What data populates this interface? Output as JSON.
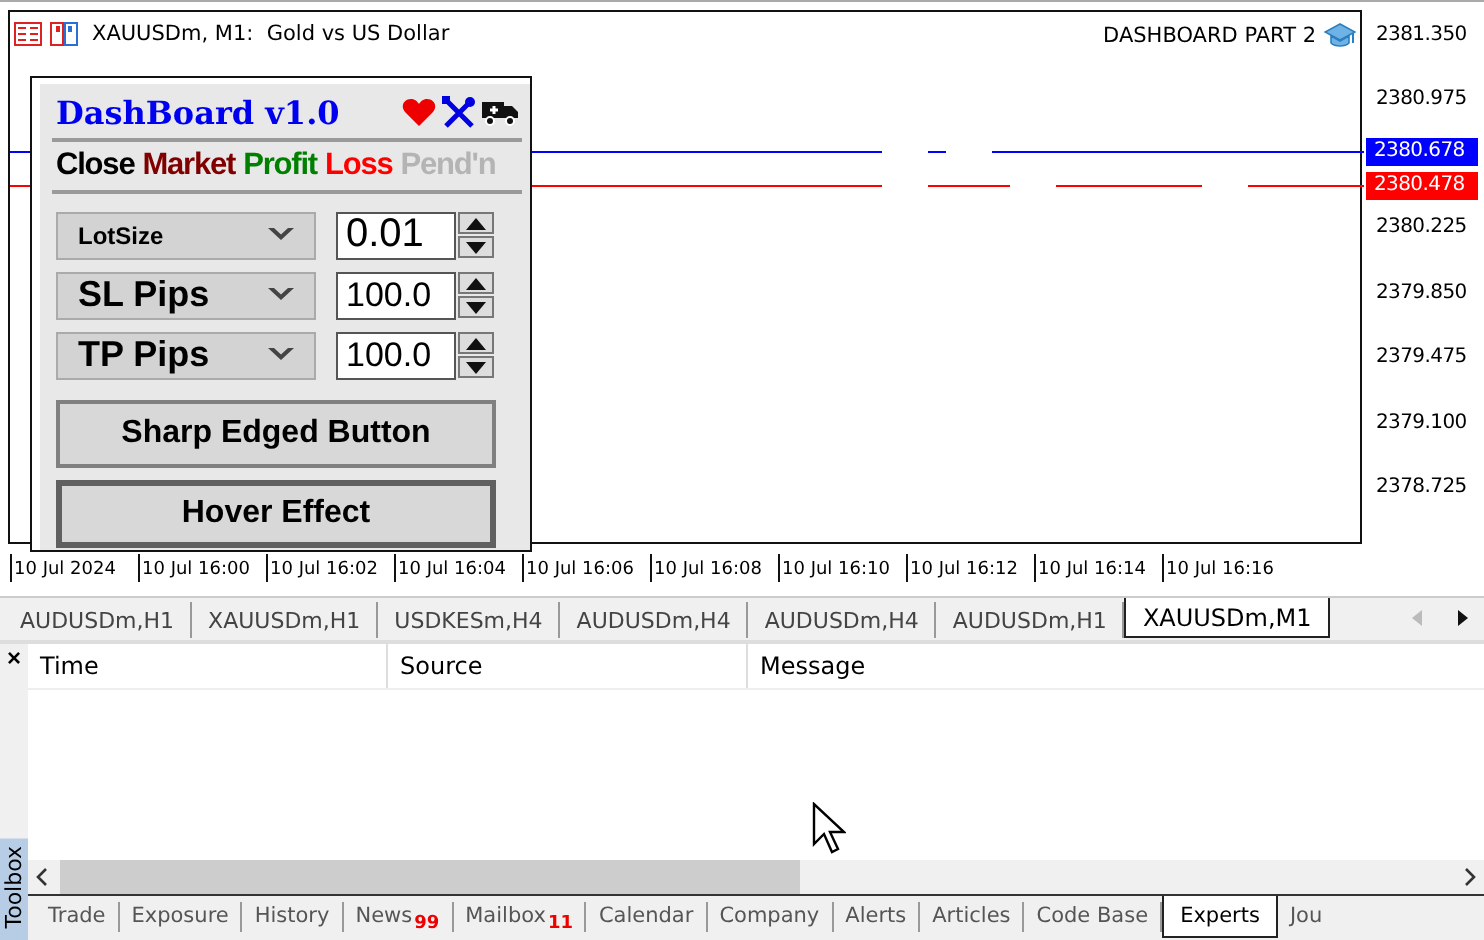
{
  "chart": {
    "title": "XAUUSDm, M1:  Gold vs US Dollar",
    "caption": "DASHBOARD PART 2",
    "price_ticks": [
      "2381.350",
      "2380.975",
      "2380.225",
      "2379.850",
      "2379.475",
      "2379.100",
      "2378.725"
    ],
    "price_labels": [
      {
        "text": "2380.678",
        "color": "#0000ff"
      },
      {
        "text": "2380.478",
        "color": "#ff0000"
      }
    ],
    "time_ticks": [
      "10 Jul 2024",
      "10 Jul 16:00",
      "10 Jul 16:02",
      "10 Jul 16:04",
      "10 Jul 16:06",
      "10 Jul 16:08",
      "10 Jul 16:10",
      "10 Jul 16:12",
      "10 Jul 16:14",
      "10 Jul 16:16"
    ]
  },
  "dashboard": {
    "title": "DashBoard v1.0",
    "actions": [
      {
        "label": "Close",
        "color": "#000000"
      },
      {
        "label": "Market",
        "color": "#800000"
      },
      {
        "label": "Profit",
        "color": "#008000"
      },
      {
        "label": "Loss",
        "color": "#ff0000"
      },
      {
        "label": "Pend'n",
        "color": "#b4b4b4"
      }
    ],
    "rows": [
      {
        "label": "LotSize",
        "value": "0.01"
      },
      {
        "label": "SL Pips",
        "value": "100.0"
      },
      {
        "label": "TP Pips",
        "value": "100.0"
      }
    ],
    "buttons": [
      "Sharp Edged Button",
      "Hover Effect"
    ]
  },
  "chart_tabs": [
    {
      "label": "AUDUSDm,H1",
      "selected": false
    },
    {
      "label": "XAUUSDm,H1",
      "selected": false
    },
    {
      "label": "USDKESm,H4",
      "selected": false
    },
    {
      "label": "AUDUSDm,H4",
      "selected": false
    },
    {
      "label": "AUDUSDm,H4",
      "selected": false
    },
    {
      "label": "AUDUSDm,H1",
      "selected": false
    },
    {
      "label": "XAUUSDm,M1",
      "selected": true
    }
  ],
  "toolbox": {
    "title": "Toolbox",
    "close": "×",
    "columns": [
      "Time",
      "Source",
      "Message"
    ],
    "tabs": [
      {
        "label": "Trade",
        "selected": false
      },
      {
        "label": "Exposure",
        "selected": false
      },
      {
        "label": "History",
        "selected": false
      },
      {
        "label": "News",
        "badge": "99",
        "selected": false
      },
      {
        "label": "Mailbox",
        "badge": "11",
        "selected": false
      },
      {
        "label": "Calendar",
        "selected": false
      },
      {
        "label": "Company",
        "selected": false
      },
      {
        "label": "Alerts",
        "selected": false
      },
      {
        "label": "Articles",
        "selected": false
      },
      {
        "label": "Code Base",
        "selected": false
      },
      {
        "label": "Experts",
        "selected": true
      },
      {
        "label": "Jou",
        "selected": false
      }
    ]
  }
}
